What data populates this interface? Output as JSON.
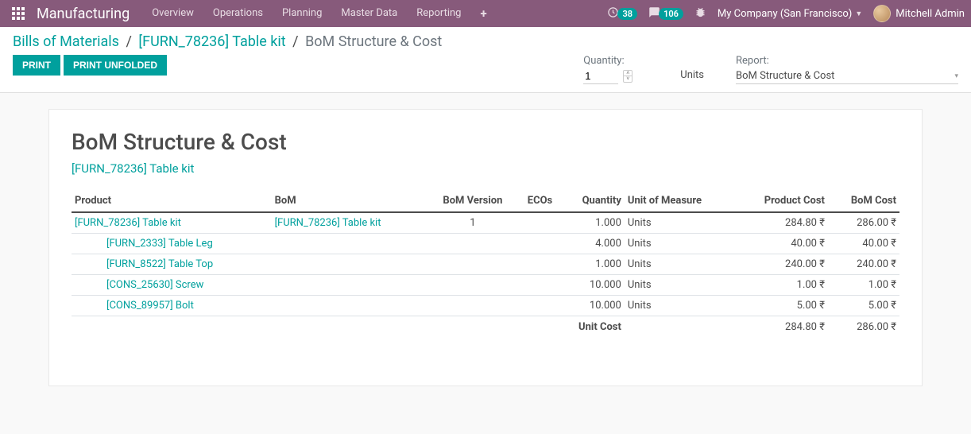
{
  "navbar": {
    "brand": "Manufacturing",
    "items": [
      "Overview",
      "Operations",
      "Planning",
      "Master Data",
      "Reporting"
    ],
    "clock_badge": "38",
    "chat_badge": "106",
    "company": "My Company (San Francisco)",
    "user": "Mitchell Admin"
  },
  "breadcrumb": {
    "root": "Bills of Materials",
    "item": "[FURN_78236] Table kit",
    "current": "BoM Structure & Cost"
  },
  "buttons": {
    "print": "Print",
    "print_unfolded": "Print Unfolded"
  },
  "controls": {
    "quantity_label": "Quantity:",
    "quantity_value": "1",
    "units_label": "Units",
    "report_label": "Report:",
    "report_value": "BoM Structure & Cost"
  },
  "report": {
    "title": "BoM Structure & Cost",
    "subtitle": "[FURN_78236] Table kit",
    "columns": {
      "product": "Product",
      "bom": "BoM",
      "bom_version": "BoM Version",
      "ecos": "ECOs",
      "quantity": "Quantity",
      "uom": "Unit of Measure",
      "product_cost": "Product Cost",
      "bom_cost": "BoM Cost"
    },
    "rows": [
      {
        "indent": 0,
        "product": "[FURN_78236] Table kit",
        "bom": "[FURN_78236] Table kit",
        "bom_version": "1",
        "ecos": "",
        "quantity": "1.000",
        "uom": "Units",
        "product_cost": "284.80 ₹",
        "bom_cost": "286.00 ₹"
      },
      {
        "indent": 1,
        "product": "[FURN_2333] Table Leg",
        "bom": "",
        "bom_version": "",
        "ecos": "",
        "quantity": "4.000",
        "uom": "Units",
        "product_cost": "40.00 ₹",
        "bom_cost": "40.00 ₹"
      },
      {
        "indent": 1,
        "product": "[FURN_8522] Table Top",
        "bom": "",
        "bom_version": "",
        "ecos": "",
        "quantity": "1.000",
        "uom": "Units",
        "product_cost": "240.00 ₹",
        "bom_cost": "240.00 ₹"
      },
      {
        "indent": 1,
        "product": "[CONS_25630] Screw",
        "bom": "",
        "bom_version": "",
        "ecos": "",
        "quantity": "10.000",
        "uom": "Units",
        "product_cost": "1.00 ₹",
        "bom_cost": "1.00 ₹"
      },
      {
        "indent": 1,
        "product": "[CONS_89957] Bolt",
        "bom": "",
        "bom_version": "",
        "ecos": "",
        "quantity": "10.000",
        "uom": "Units",
        "product_cost": "5.00 ₹",
        "bom_cost": "5.00 ₹"
      }
    ],
    "footer": {
      "label": "Unit Cost",
      "product_cost": "284.80 ₹",
      "bom_cost": "286.00 ₹"
    }
  }
}
